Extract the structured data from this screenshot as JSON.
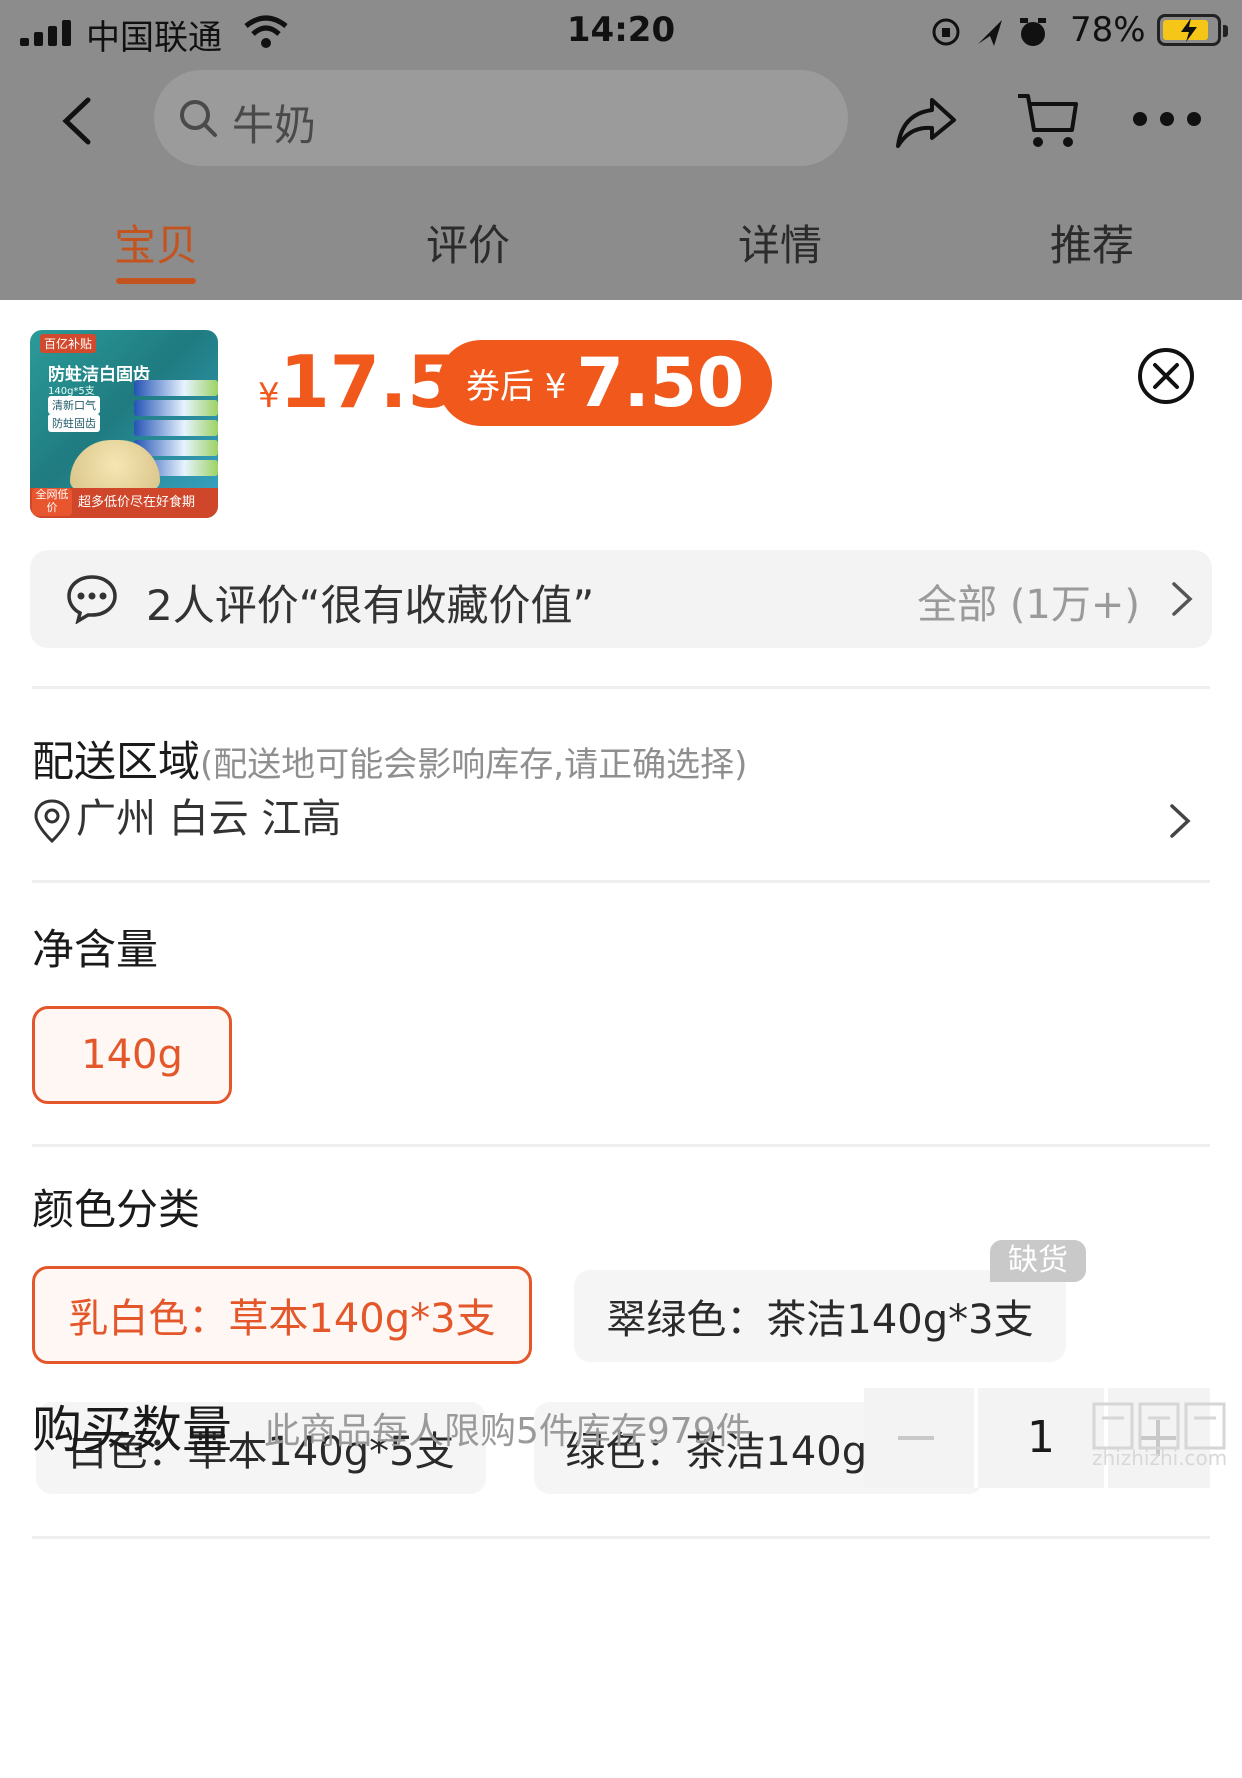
{
  "status_bar": {
    "carrier": "中国联通",
    "time": "14:20",
    "battery": "78%"
  },
  "nav": {
    "search_placeholder": "牛奶"
  },
  "tabs": [
    {
      "label": "宝贝",
      "active": true
    },
    {
      "label": "评价",
      "active": false
    },
    {
      "label": "详情",
      "active": false
    },
    {
      "label": "推荐",
      "active": false
    }
  ],
  "product": {
    "thumb_text": {
      "badge": "百亿补贴",
      "name": "防蛀洁白固齿",
      "spec": "140g*5支",
      "tag1": "清新口气",
      "tag2": "防蛀固齿",
      "footer_badge": "全网低价",
      "footer": "超多低价尽在好食期"
    },
    "price_symbol": "¥",
    "price": "17.5",
    "coupon_label": "券后 ¥",
    "coupon_price": "7.50"
  },
  "review_bar": {
    "text": "2人评价“很有收藏价值”",
    "all": "全部 (1万+)"
  },
  "delivery": {
    "title": "配送区域",
    "hint": "(配送地可能会影响库存,请正确选择)",
    "address": "广州 白云 江高"
  },
  "net_content": {
    "title": "净含量",
    "options": [
      "140g"
    ]
  },
  "color": {
    "title": "颜色分类",
    "options": [
      {
        "label": "乳白色：草本140g*3支",
        "selected": true
      },
      {
        "label": "翠绿色：茶洁140g*3支",
        "selected": false,
        "badge": "缺货"
      },
      {
        "label": "白色：草本140g*5支",
        "selected": false
      },
      {
        "label": "绿色：茶洁140g*5支",
        "selected": false
      }
    ]
  },
  "quantity": {
    "title": "购买数量",
    "note": "此商品每人限购5件库存979件",
    "value": "1"
  },
  "watermark": "zhizhizhi.com",
  "colors": {
    "accent": "#f0581c",
    "selected_border": "#e3572a",
    "overlay": "#8c8c8c"
  }
}
